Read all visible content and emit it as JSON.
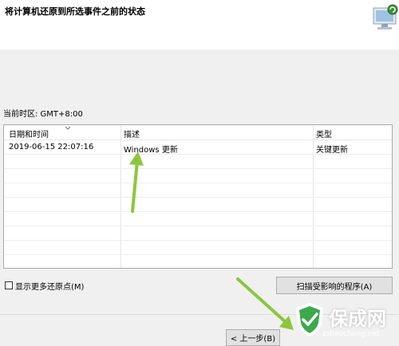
{
  "header": {
    "title": "将计算机还原到所选事件之前的状态",
    "icon": "system-restore-icon"
  },
  "timezone_label": "当前时区: GMT+8:00",
  "table": {
    "columns": [
      "日期和时间",
      "描述",
      "类型"
    ],
    "rows": [
      {
        "datetime": "2019-06-15 22:07:16",
        "description": "Windows 更新",
        "type": "关键更新"
      }
    ]
  },
  "options": {
    "show_more_label": "显示更多还原点(M)",
    "show_more_checked": false
  },
  "buttons": {
    "scan_label": "扫描受影响的程序(A)",
    "back_label": "< 上一步(B)"
  },
  "watermark": {
    "brand": "保成网",
    "url": "zsbaocheng.net",
    "shield_icon": "shield-check-icon"
  },
  "colors": {
    "annotation_arrow": "#8cc63f"
  }
}
